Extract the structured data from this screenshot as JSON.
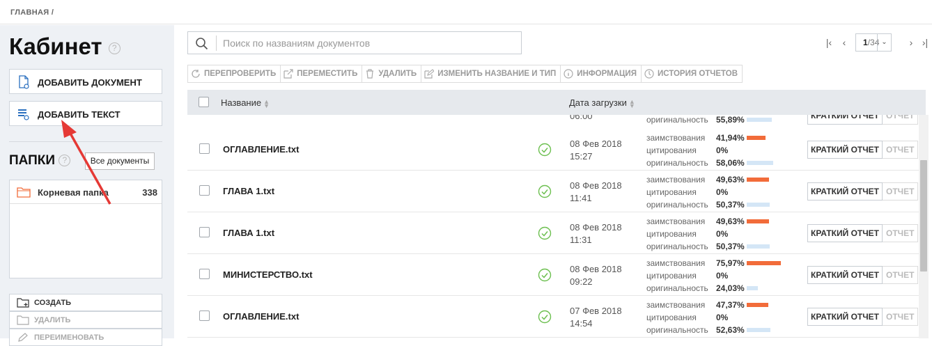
{
  "breadcrumb": "ГЛАВНАЯ /",
  "sidebar": {
    "title": "Кабинет",
    "help": "?",
    "add_document": "ДОБАВИТЬ ДОКУМЕНТ",
    "add_text": "ДОБАВИТЬ ТЕКСТ",
    "folders_title": "ПАПКИ",
    "all_documents": "Все документы",
    "root_folder": {
      "name": "Корневая папка",
      "count": "338"
    },
    "actions": {
      "create": "СОЗДАТЬ",
      "delete": "УДАЛИТЬ",
      "rename": "ПЕРЕИМЕНОВАТЬ"
    }
  },
  "search": {
    "placeholder": "Поиск по названиям документов"
  },
  "pager": {
    "current": "1",
    "total": "/34"
  },
  "toolbar": {
    "recheck": "ПЕРЕПРОВЕРИТЬ",
    "move": "ПЕРЕМЕСТИТЬ",
    "delete": "УДАЛИТЬ",
    "rename_type": "ИЗМЕНИТЬ НАЗВАНИЕ И ТИП",
    "info": "ИНФОРМАЦИЯ",
    "history": "ИСТОРИЯ ОТЧЕТОВ"
  },
  "table": {
    "col_name": "Название",
    "col_date": "Дата загрузки",
    "labels": {
      "borrow": "заимствования",
      "cite": "цитирования",
      "orig": "оригинальность"
    },
    "short_report": "КРАТКИЙ ОТЧЕТ",
    "report": "ОТЧЕТ",
    "partial_row": {
      "time": "06:00",
      "orig": "55,89%",
      "orig_frac": 0.5589
    },
    "rows": [
      {
        "name": "ОГЛАВЛЕНИЕ.txt",
        "date": "08 Фев 2018",
        "time": "15:27",
        "borrow": "41,94%",
        "cite": "0%",
        "orig": "58,06%",
        "borrow_frac": 0.4194,
        "orig_frac": 0.5806
      },
      {
        "name": "ГЛАВА 1.txt",
        "date": "08 Фев 2018",
        "time": "11:41",
        "borrow": "49,63%",
        "cite": "0%",
        "orig": "50,37%",
        "borrow_frac": 0.4963,
        "orig_frac": 0.5037
      },
      {
        "name": "ГЛАВА 1.txt",
        "date": "08 Фев 2018",
        "time": "11:31",
        "borrow": "49,63%",
        "cite": "0%",
        "orig": "50,37%",
        "borrow_frac": 0.4963,
        "orig_frac": 0.5037
      },
      {
        "name": "МИНИСТЕРСТВО.txt",
        "date": "08 Фев 2018",
        "time": "09:22",
        "borrow": "75,97%",
        "cite": "0%",
        "orig": "24,03%",
        "borrow_frac": 0.7597,
        "orig_frac": 0.2403
      },
      {
        "name": "ОГЛАВЛЕНИЕ.txt",
        "date": "07 Фев 2018",
        "time": "14:54",
        "borrow": "47,37%",
        "cite": "0%",
        "orig": "52,63%",
        "borrow_frac": 0.4737,
        "orig_frac": 0.5263
      }
    ]
  },
  "colors": {
    "accent_orange": "#f26c3a",
    "orig_blue": "#d4e6f6",
    "ok_green": "#6cbf4f",
    "arrow_red": "#e53935"
  }
}
